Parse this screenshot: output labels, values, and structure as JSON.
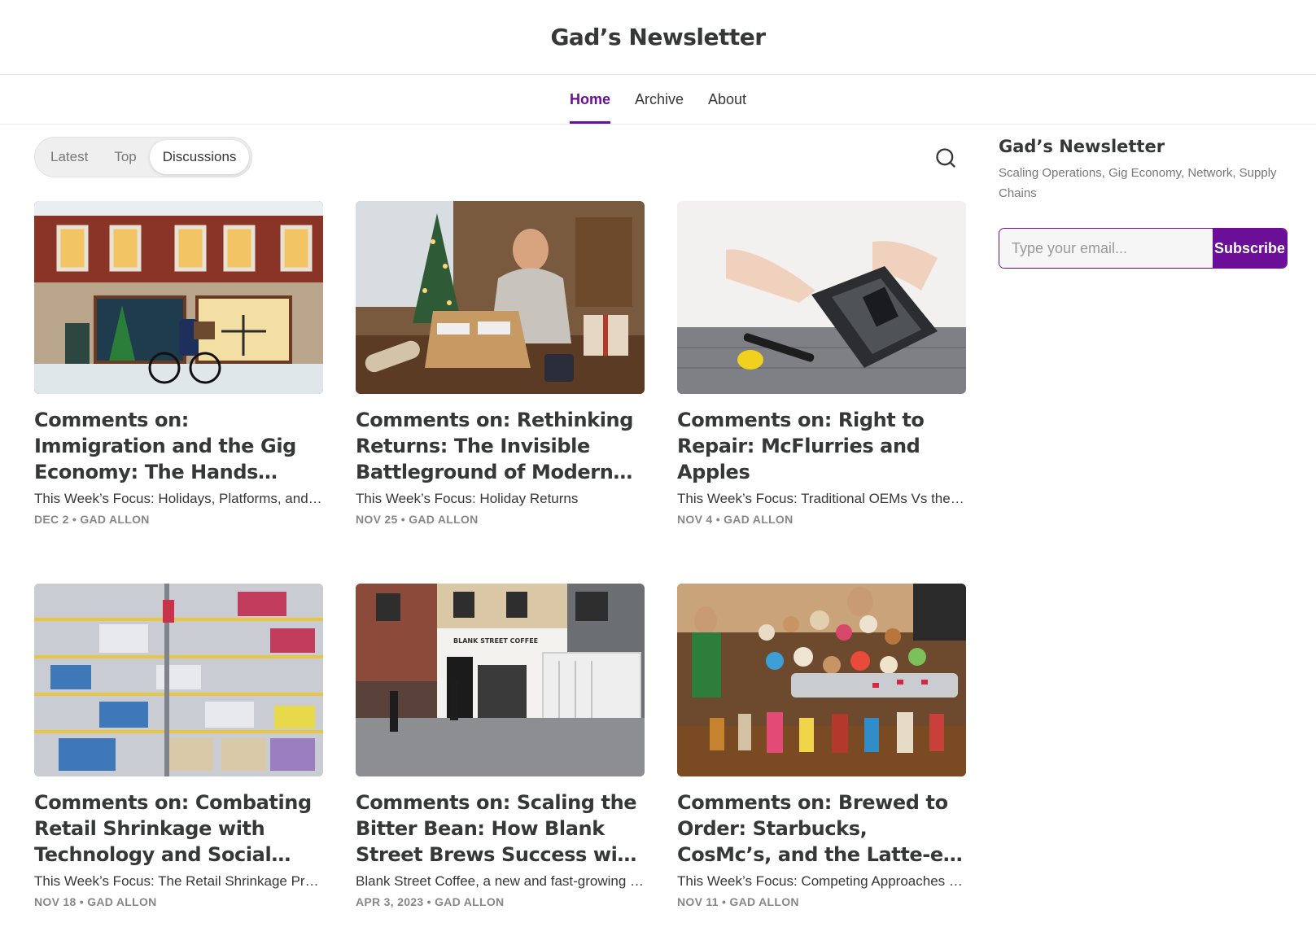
{
  "site": {
    "title": "Gad’s Newsletter"
  },
  "nav": {
    "items": [
      {
        "label": "Home"
      },
      {
        "label": "Archive"
      },
      {
        "label": "About"
      }
    ]
  },
  "filters": {
    "tabs": [
      {
        "label": "Latest"
      },
      {
        "label": "Top"
      },
      {
        "label": "Discussions"
      }
    ]
  },
  "posts": [
    {
      "title": "Comments on: Immigration and the Gig Economy: The Hands Behind Your Holiday Deliveries",
      "subtitle": "This Week’s Focus: Holidays, Platforms, and Immigration",
      "date": "DEC 2",
      "author": "GAD ALLON",
      "image": "holiday-delivery-street-illustration"
    },
    {
      "title": "Comments on: Rethinking Returns: The Invisible Battleground of Modern Retail",
      "subtitle": "This Week’s Focus: Holiday Returns",
      "date": "NOV 25",
      "author": "GAD ALLON",
      "image": "man-packing-return-box"
    },
    {
      "title": "Comments on: Right to Repair: McFlurries and Apples",
      "subtitle": "This Week’s Focus: Traditional OEMs Vs the Repair Movement",
      "date": "NOV 4",
      "author": "GAD ALLON",
      "image": "hands-repairing-phone"
    },
    {
      "title": "Comments on: Combating Retail Shrinkage with Technology and Social Responsibility",
      "subtitle": "This Week’s Focus: The Retail Shrinkage Problem",
      "date": "NOV 18",
      "author": "GAD ALLON",
      "image": "locked-store-shelves"
    },
    {
      "title": "Comments on: Scaling the Bitter Bean: How Blank Street Brews Success with a Dash of Data",
      "subtitle": "Blank Street Coffee, a new and fast-growing coffee chain",
      "date": "APR 3, 2023",
      "author": "GAD ALLON",
      "image": "blank-street-coffee-storefront",
      "sign": "BLANK STREET COFFEE"
    },
    {
      "title": "Comments on: Brewed to Order: Starbucks, CosMc’s, and the Latte-est Trends in Customization",
      "subtitle": "This Week’s Focus: Competing Approaches to Customization",
      "date": "NOV 11",
      "author": "GAD ALLON",
      "image": "baristas-overflowing-drink-orders"
    }
  ],
  "sidebar": {
    "title": "Gad’s Newsletter",
    "description": "Scaling Operations, Gig Economy, Network, Supply Chains",
    "email_placeholder": "Type your email...",
    "subscribe_label": "Subscribe"
  },
  "colors": {
    "accent": "#6b0f99",
    "text": "#363737",
    "muted": "#868787"
  }
}
